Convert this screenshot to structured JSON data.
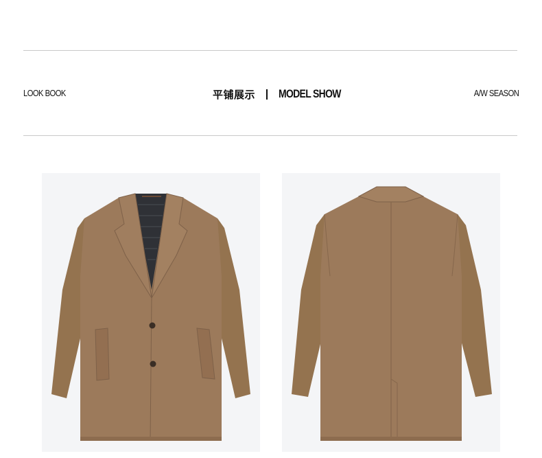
{
  "header": {
    "left_label": "LOOK BOOK",
    "title_cn": "平铺展示",
    "title_en": "MODEL SHOW",
    "right_label": "A/W SEASON"
  },
  "products": [
    {
      "view": "front",
      "coat_color": "#9c7a5b"
    },
    {
      "view": "back",
      "coat_color": "#9c7a5b"
    }
  ],
  "colors": {
    "photo_background": "#f4f5f7",
    "rule": "#c9c9c9",
    "coat": "#9c7a5b",
    "coat_shadow": "#7e6149",
    "lining": "#2f3136"
  }
}
